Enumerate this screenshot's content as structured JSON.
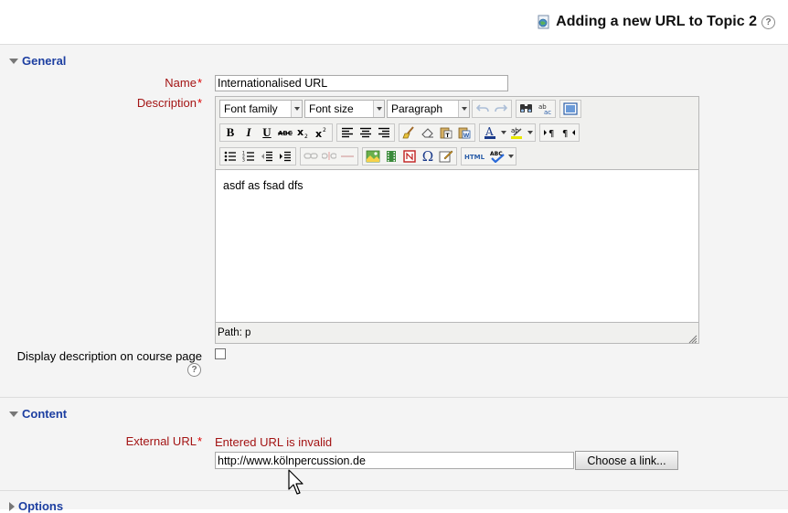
{
  "header": {
    "title": "Adding a new URL to Topic 2",
    "help_symbol": "?"
  },
  "general": {
    "legend": "General",
    "name_label": "Name",
    "required_marker": "*",
    "name_value": "Internationalised URL",
    "description_label": "Description",
    "display_desc_label": "Display description on course page",
    "display_desc_checked": false
  },
  "editor": {
    "font_family": "Font family",
    "font_size": "Font size",
    "format": "Paragraph",
    "content": "asdf as fsad dfs",
    "path": "Path: p",
    "icons": {
      "row1": [
        "undo-icon",
        "redo-icon",
        "find-icon",
        "replace-icon",
        "fullscreen-icon"
      ],
      "row2": [
        "bold-icon",
        "italic-icon",
        "underline-icon",
        "strikethrough-icon",
        "subscript-icon",
        "superscript-icon",
        "align-left-icon",
        "align-center-icon",
        "align-right-icon",
        "cleanup-icon",
        "eraser-icon",
        "paste-text-icon",
        "paste-word-icon",
        "text-color-icon",
        "highlight-color-icon",
        "ltr-icon",
        "rtl-icon"
      ],
      "row3": [
        "bullet-list-icon",
        "numbered-list-icon",
        "outdent-icon",
        "indent-icon",
        "link-icon",
        "unlink-icon",
        "anchor-icon",
        "image-icon",
        "media-icon",
        "table-icon",
        "special-char-icon",
        "edit-icon",
        "html-icon",
        "spellcheck-icon"
      ]
    }
  },
  "content": {
    "legend": "Content",
    "external_url_label": "External URL",
    "error": "Entered URL is invalid",
    "url_value": "http://www.kölnpercussion.de",
    "choose_link": "Choose a link..."
  },
  "options": {
    "legend": "Options"
  },
  "colors": {
    "legend": "#1d3fa1",
    "label_required": "#a31414",
    "asterisk": "#dd0000",
    "fieldset_bg": "#f4f4f4"
  }
}
